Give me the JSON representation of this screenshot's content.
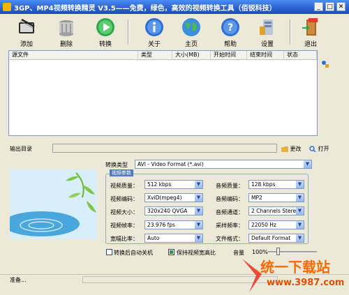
{
  "window": {
    "title": "3GP、MP4视频转换精灵 V3.5——免费，绿色，高效的视频转换工具（佰锐科技）"
  },
  "toolbar": {
    "add": "添加",
    "delete": "删除",
    "convert": "转换",
    "about": "关于",
    "home": "主页",
    "help": "帮助",
    "settings": "设置",
    "exit": "退出"
  },
  "filelist": {
    "columns": [
      "源文件",
      "类型",
      "大小(MB)",
      "开始时间",
      "结束时间",
      "状态"
    ]
  },
  "output": {
    "dir_label": "输出目录",
    "dir_value": "",
    "change": "更改",
    "open": "打开"
  },
  "convert": {
    "type_label": "转换类型",
    "type_value": "AVI - Video Format (*.avi)",
    "group_label": "视频参数"
  },
  "params": {
    "video_quality_label": "视频质量：",
    "video_quality": "512 kbps",
    "video_codec_label": "视频编码：",
    "video_codec": "XviD(mpeg4)",
    "video_size_label": "视频大小：",
    "video_size": "320x240 QVGA",
    "frame_rate_label": "视频帧率：",
    "frame_rate": "23.976 fps",
    "aspect_label": "宽幅比率：",
    "aspect": "Auto",
    "audio_quality_label": "音频质量：",
    "audio_quality": "128 kbps",
    "audio_codec_label": "音频编码：",
    "audio_codec": "MP2",
    "audio_channel_label": "音频通道：",
    "audio_channel": "2 Channels Stere",
    "sample_rate_label": "采样频率：",
    "sample_rate": "22050 Hz",
    "file_format_label": "文件格式：",
    "file_format": "Default Format"
  },
  "options": {
    "shutdown_label": "转换后自动关机",
    "shutdown_checked": false,
    "keep_aspect_label": "保持视频宽高比",
    "keep_aspect_checked": true,
    "volume_label": "音量",
    "volume_value": "100%",
    "volume_level": 0.0
  },
  "status": {
    "text": "准备..."
  },
  "watermark": {
    "text": "统一下载站",
    "url": "www.3987.com"
  },
  "colors": {
    "title_bar": "#2b5fd0",
    "accent": "#ff6a00"
  }
}
